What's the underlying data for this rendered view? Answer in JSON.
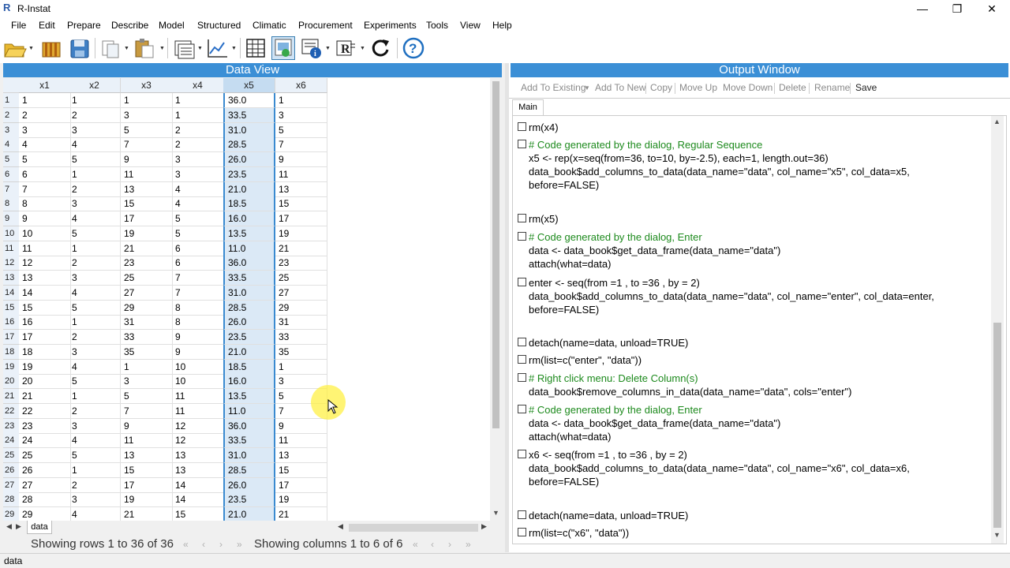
{
  "window": {
    "title": "R-Instat",
    "minimize": "—",
    "restore": "❐",
    "close": "✕"
  },
  "menu": [
    "File",
    "Edit",
    "Prepare",
    "Describe",
    "Model",
    "Structured",
    "Climatic",
    "Procurement",
    "Experiments",
    "Tools",
    "View",
    "Help"
  ],
  "toolbar_icons": [
    "open-folder-icon",
    "open-library-icon",
    "save-icon",
    "copy-icon",
    "paste-icon",
    "data-options-icon",
    "last-graph-icon",
    "view-data-grid-icon",
    "view-output-icon",
    "metadata-icon",
    "script-window-icon",
    "reset-icon",
    "help-icon"
  ],
  "data_view": {
    "header": "Data View",
    "columns": [
      "x1",
      "x2",
      "x3",
      "x4",
      "x5",
      "x6"
    ],
    "rows": [
      [
        "1",
        "1",
        "1",
        "1",
        "1",
        "36.0",
        "1"
      ],
      [
        "2",
        "2",
        "2",
        "3",
        "1",
        "33.5",
        "3"
      ],
      [
        "3",
        "3",
        "3",
        "5",
        "2",
        "31.0",
        "5"
      ],
      [
        "4",
        "4",
        "4",
        "7",
        "2",
        "28.5",
        "7"
      ],
      [
        "5",
        "5",
        "5",
        "9",
        "3",
        "26.0",
        "9"
      ],
      [
        "6",
        "6",
        "1",
        "11",
        "3",
        "23.5",
        "11"
      ],
      [
        "7",
        "7",
        "2",
        "13",
        "4",
        "21.0",
        "13"
      ],
      [
        "8",
        "8",
        "3",
        "15",
        "4",
        "18.5",
        "15"
      ],
      [
        "9",
        "9",
        "4",
        "17",
        "5",
        "16.0",
        "17"
      ],
      [
        "10",
        "10",
        "5",
        "19",
        "5",
        "13.5",
        "19"
      ],
      [
        "11",
        "11",
        "1",
        "21",
        "6",
        "11.0",
        "21"
      ],
      [
        "12",
        "12",
        "2",
        "23",
        "6",
        "36.0",
        "23"
      ],
      [
        "13",
        "13",
        "3",
        "25",
        "7",
        "33.5",
        "25"
      ],
      [
        "14",
        "14",
        "4",
        "27",
        "7",
        "31.0",
        "27"
      ],
      [
        "15",
        "15",
        "5",
        "29",
        "8",
        "28.5",
        "29"
      ],
      [
        "16",
        "16",
        "1",
        "31",
        "8",
        "26.0",
        "31"
      ],
      [
        "17",
        "17",
        "2",
        "33",
        "9",
        "23.5",
        "33"
      ],
      [
        "18",
        "18",
        "3",
        "35",
        "9",
        "21.0",
        "35"
      ],
      [
        "19",
        "19",
        "4",
        "1",
        "10",
        "18.5",
        "1"
      ],
      [
        "20",
        "20",
        "5",
        "3",
        "10",
        "16.0",
        "3"
      ],
      [
        "21",
        "21",
        "1",
        "5",
        "11",
        "13.5",
        "5"
      ],
      [
        "22",
        "22",
        "2",
        "7",
        "11",
        "11.0",
        "7"
      ],
      [
        "23",
        "23",
        "3",
        "9",
        "12",
        "36.0",
        "9"
      ],
      [
        "24",
        "24",
        "4",
        "11",
        "12",
        "33.5",
        "11"
      ],
      [
        "25",
        "25",
        "5",
        "13",
        "13",
        "31.0",
        "13"
      ],
      [
        "26",
        "26",
        "1",
        "15",
        "13",
        "28.5",
        "15"
      ],
      [
        "27",
        "27",
        "2",
        "17",
        "14",
        "26.0",
        "17"
      ],
      [
        "28",
        "28",
        "3",
        "19",
        "14",
        "23.5",
        "19"
      ],
      [
        "29",
        "29",
        "4",
        "21",
        "15",
        "21.0",
        "21"
      ]
    ],
    "sheet_tab": "data",
    "rows_text": "Showing rows 1 to 36 of 36",
    "cols_text": "Showing columns 1 to 6 of 6"
  },
  "output": {
    "header": "Output Window",
    "actions": [
      "Add To Existing",
      "Add To New",
      "Copy",
      "Move Up",
      "Move Down",
      "Delete",
      "Rename",
      "Save"
    ],
    "tab": "Main",
    "entries": [
      {
        "lines": [
          {
            "t": "rm(x4)",
            "c": false
          }
        ]
      },
      {
        "lines": [
          {
            "t": "# Code generated by the dialog, Regular Sequence",
            "c": true
          },
          {
            "t": "x5 <- rep(x=seq(from=36, to=10, by=-2.5), each=1, length.out=36)",
            "c": false
          },
          {
            "t": "data_book$add_columns_to_data(data_name=\"data\", col_name=\"x5\", col_data=x5,",
            "c": false
          },
          {
            "t": "before=FALSE)",
            "c": false
          }
        ]
      },
      {
        "lines": [
          {
            "t": "rm(x5)",
            "c": false
          }
        ]
      },
      {
        "lines": [
          {
            "t": "# Code generated by the dialog, Enter",
            "c": true
          },
          {
            "t": "data <- data_book$get_data_frame(data_name=\"data\")",
            "c": false
          },
          {
            "t": "attach(what=data)",
            "c": false
          }
        ]
      },
      {
        "lines": [
          {
            "t": "enter <- seq(from =1 , to =36 , by = 2)",
            "c": false
          },
          {
            "t": "data_book$add_columns_to_data(data_name=\"data\", col_name=\"enter\", col_data=enter,",
            "c": false
          },
          {
            "t": "before=FALSE)",
            "c": false
          }
        ]
      },
      {
        "lines": [
          {
            "t": "detach(name=data, unload=TRUE)",
            "c": false
          }
        ]
      },
      {
        "lines": [
          {
            "t": "rm(list=c(\"enter\", \"data\"))",
            "c": false
          }
        ]
      },
      {
        "lines": [
          {
            "t": "# Right click menu: Delete Column(s)",
            "c": true
          },
          {
            "t": "data_book$remove_columns_in_data(data_name=\"data\", cols=\"enter\")",
            "c": false
          }
        ]
      },
      {
        "lines": [
          {
            "t": "# Code generated by the dialog, Enter",
            "c": true
          },
          {
            "t": "data <- data_book$get_data_frame(data_name=\"data\")",
            "c": false
          },
          {
            "t": "attach(what=data)",
            "c": false
          }
        ]
      },
      {
        "lines": [
          {
            "t": "x6 <- seq(from =1 , to =36 , by = 2)",
            "c": false
          },
          {
            "t": "data_book$add_columns_to_data(data_name=\"data\", col_name=\"x6\", col_data=x6,",
            "c": false
          },
          {
            "t": "before=FALSE)",
            "c": false
          }
        ]
      },
      {
        "lines": [
          {
            "t": "detach(name=data, unload=TRUE)",
            "c": false
          }
        ]
      },
      {
        "lines": [
          {
            "t": "rm(list=c(\"x6\", \"data\"))",
            "c": false
          }
        ]
      }
    ]
  },
  "status": {
    "text": "data"
  },
  "colors": {
    "panel_header": "#3b8fd6",
    "comment": "#1d8a1d",
    "selected_col": "#dbe9f6"
  }
}
